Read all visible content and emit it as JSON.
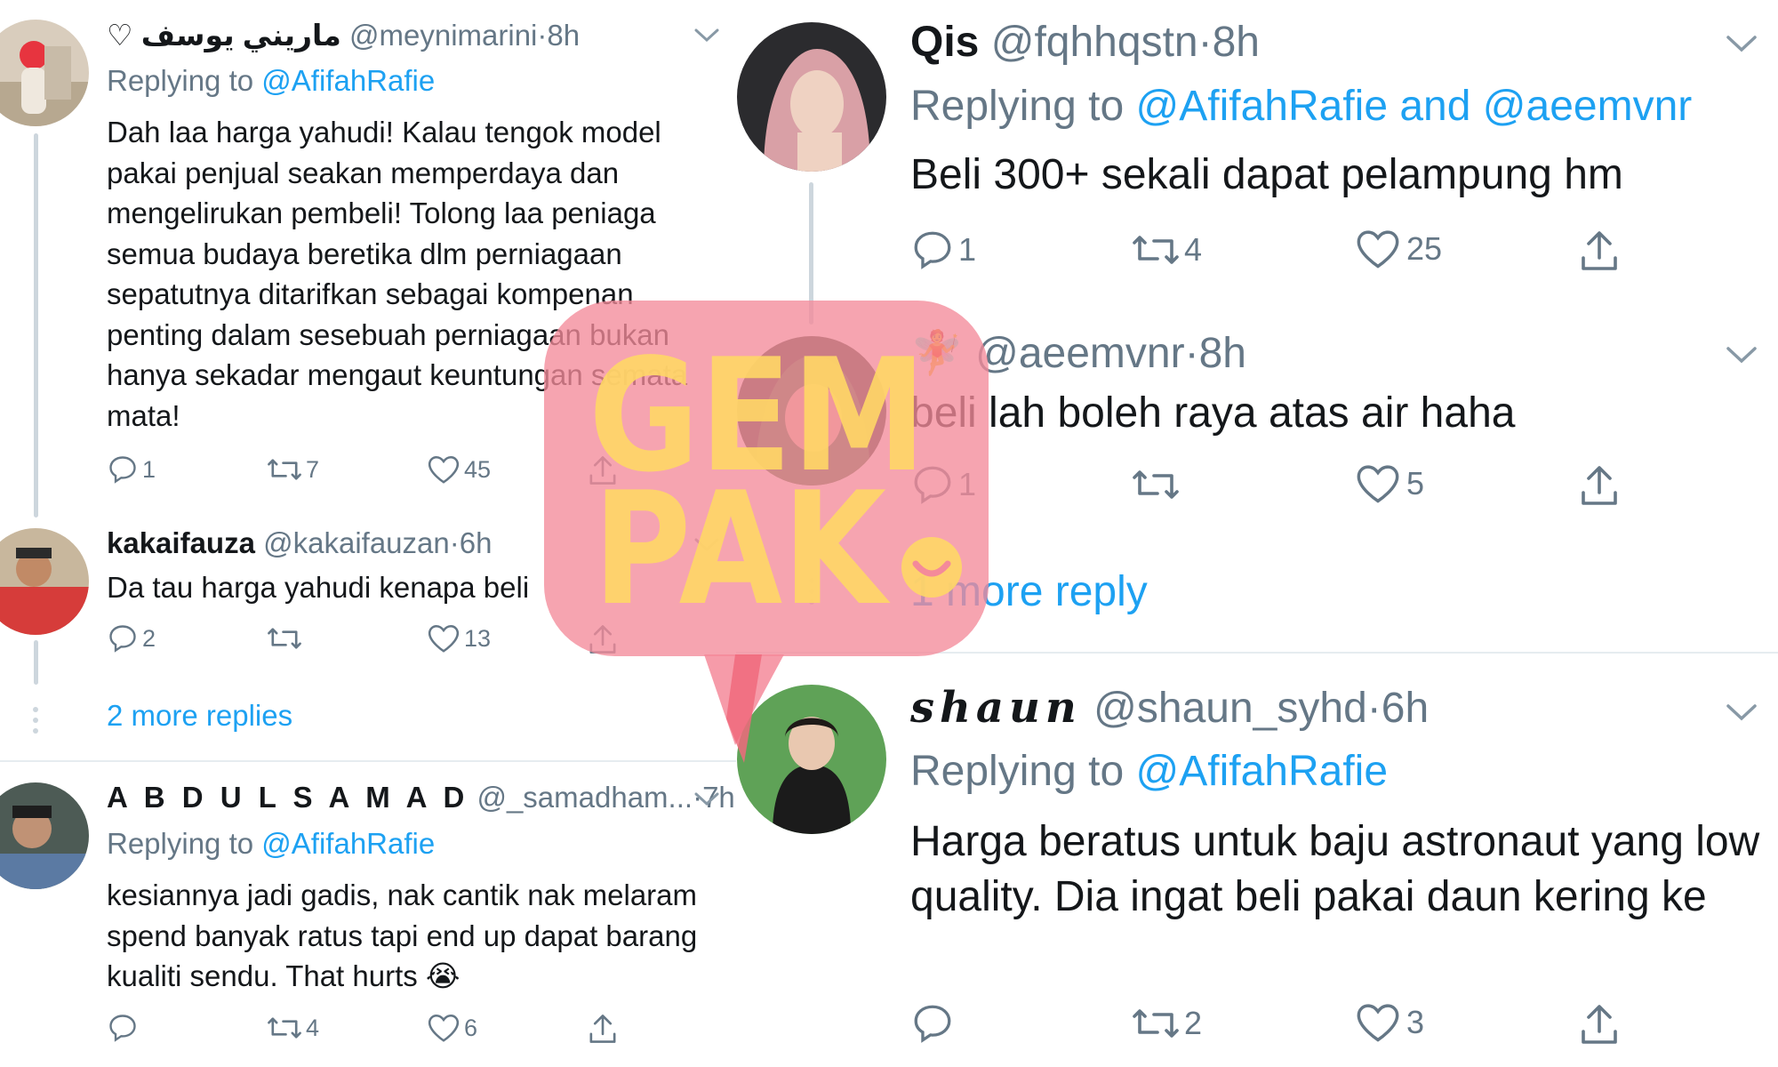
{
  "left_column": {
    "tweet1": {
      "name": "ماريني يوسف ♡",
      "handle": "@meynimarini",
      "dot": "·",
      "time": "8h",
      "replying_label": "Replying to",
      "replying_to": "@AfifahRafie",
      "text": "Dah laa harga yahudi! Kalau tengok model pakai penjual seakan memperdaya dan mengelirukan pembeli! Tolong laa peniaga semua budaya beretika dlm perniagaan sepatutnya ditarifkan sebagai kompenan penting dalam sesebuah perniagaan bukan hanya sekadar mengaut keuntungan semata mata!",
      "replies": "1",
      "retweets": "7",
      "likes": "45"
    },
    "tweet2": {
      "name": "kakaifauza",
      "handle": "@kakaifauzan",
      "dot": "·",
      "time": "6h",
      "text": "Da tau harga yahudi kenapa beli",
      "replies": "2",
      "retweets": "",
      "likes": "13"
    },
    "more_replies": "2 more replies",
    "tweet3": {
      "name": "A B D U L S A M A D",
      "handle": "@_samadham...",
      "dot": "·",
      "time": "7h",
      "replying_label": "Replying to",
      "replying_to": "@AfifahRafie",
      "text": "kesiannya jadi gadis, nak cantik nak melaram spend banyak ratus tapi end up dapat barang kualiti sendu. That hurts 😭",
      "replies": "",
      "retweets": "4",
      "likes": "6"
    }
  },
  "right_column": {
    "tweet1": {
      "name": "Qis",
      "handle": "@fqhhqstn",
      "dot": "·",
      "time": "8h",
      "replying_label": "Replying to",
      "replying_to": "@AfifahRafie and @aeemvnr",
      "text": "Beli 300+ sekali dapat pelampung hm",
      "replies": "1",
      "retweets": "4",
      "likes": "25"
    },
    "tweet2": {
      "name": "🧚",
      "handle": "@aeemvnr",
      "dot": "·",
      "time": "8h",
      "text": "beli lah boleh raya atas air haha",
      "replies": "1",
      "retweets": "",
      "likes": "5"
    },
    "more_reply": "1 more reply",
    "tweet3": {
      "name": "𝓼𝓱𝓪𝓾𝓷",
      "name_plain": "shaun",
      "handle": "@shaun_syhd",
      "dot": "·",
      "time": "6h",
      "replying_label": "Replying to",
      "replying_to": "@AfifahRafie",
      "text": "Harga beratus untuk baju astronaut yang low quality. Dia ingat beli pakai daun kering ke",
      "replies": "",
      "retweets": "2",
      "likes": "3"
    }
  },
  "watermark": {
    "line1": "GEM",
    "line2": "PAK",
    "bg_color": "#f48a9a",
    "text_color": "#ffd766"
  },
  "colors": {
    "link": "#1da1f2",
    "secondary": "#657786",
    "text": "#14171a",
    "divider": "#e6ecf0"
  }
}
